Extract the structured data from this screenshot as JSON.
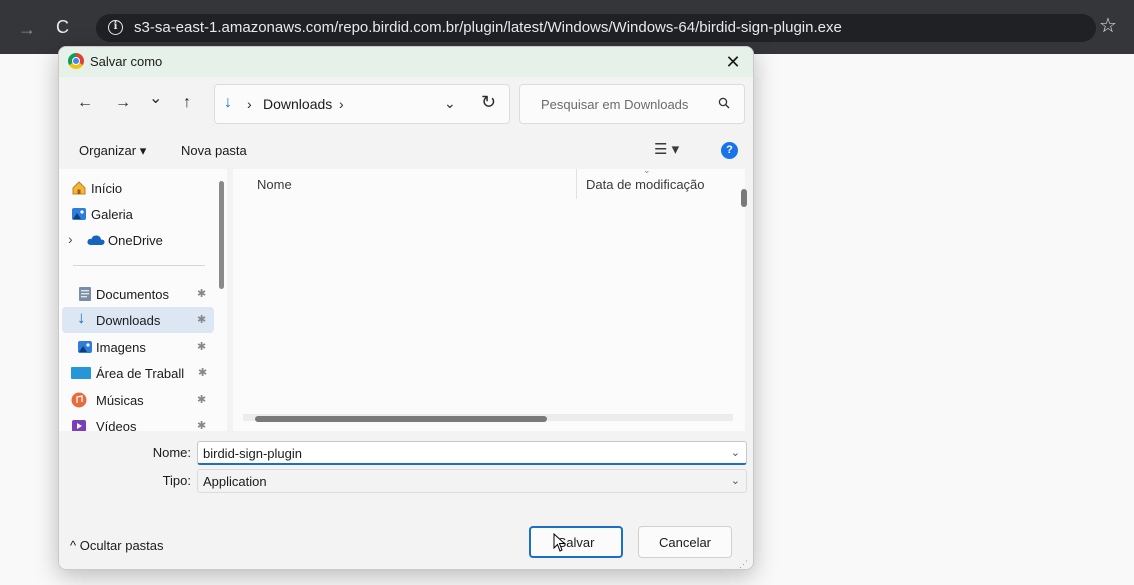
{
  "browser": {
    "url": "s3-sa-east-1.amazonaws.com/repo.birdid.com.br/plugin/latest/Windows/Windows-64/birdid-sign-plugin.exe",
    "info_glyph": "i"
  },
  "dialog": {
    "title": "Salvar como",
    "close_glyph": "✕",
    "nav": {
      "back": "←",
      "forward": "→",
      "recent": "⌄",
      "up": "↑"
    },
    "address": {
      "path_icon": "↓",
      "sep1": "›",
      "folder": "Downloads",
      "sep2": "›",
      "dropdown": "⌄",
      "refresh": "↻"
    },
    "search": {
      "placeholder": "Pesquisar em Downloads"
    },
    "commands": {
      "organize": "Organizar ▾",
      "new_folder": "Nova pasta",
      "view": "☰ ▾",
      "help": "?"
    },
    "sidebar": {
      "items": [
        {
          "label": "Início",
          "icon": "home-icon"
        },
        {
          "label": "Galeria",
          "icon": "gallery-icon"
        },
        {
          "label": "OneDrive",
          "icon": "cloud-icon",
          "expand": "›"
        },
        {
          "label": "Documentos",
          "icon": "documents-icon",
          "pin": "✱"
        },
        {
          "label": "Downloads",
          "icon": "download-icon",
          "pin": "✱"
        },
        {
          "label": "Imagens",
          "icon": "pictures-icon",
          "pin": "✱"
        },
        {
          "label": "Área de Traball",
          "icon": "desktop-icon",
          "pin": "✱"
        },
        {
          "label": "Músicas",
          "icon": "music-icon",
          "pin": "✱"
        },
        {
          "label": "Vídeos",
          "icon": "videos-icon",
          "pin": "✱"
        }
      ]
    },
    "filelist": {
      "col_name": "Nome",
      "col_date": "Data de modificação",
      "col_chevron": "⌄"
    },
    "fields": {
      "name_label": "Nome:",
      "name_value": "birdid-sign-plugin",
      "type_label": "Tipo:",
      "type_value": "Application",
      "chevron": "⌄"
    },
    "footer": {
      "hide_folders": "^ Ocultar pastas",
      "save": "Salvar",
      "cancel": "Cancelar",
      "grip": "⋰"
    }
  },
  "colors": {
    "accent": "#1a6fc9",
    "selected": "#dde7f3",
    "titlebar": "#e6f1e9",
    "browser": "#35363a"
  }
}
